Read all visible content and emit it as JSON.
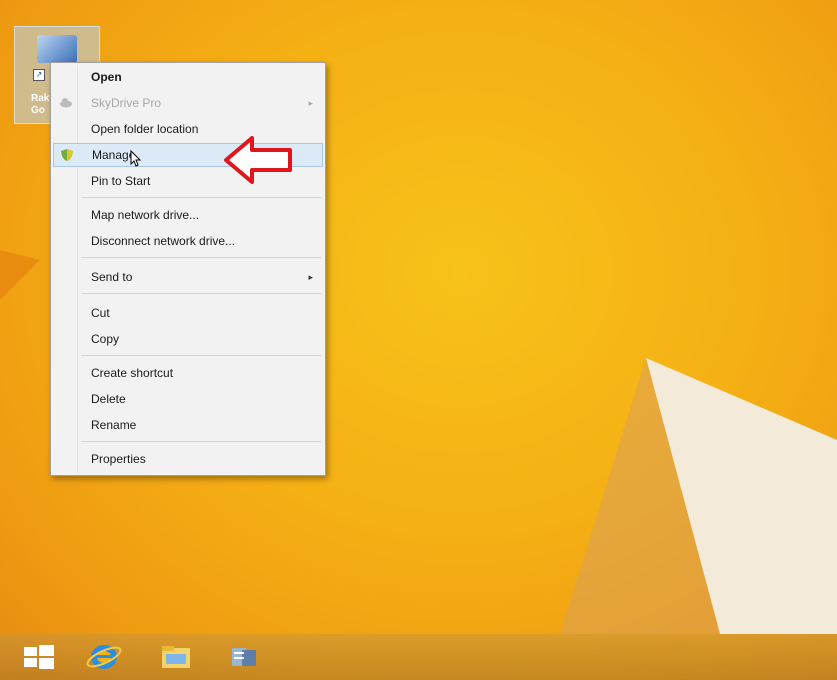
{
  "desktop_icon": {
    "label_line1": "Rak",
    "label_line2": "Go"
  },
  "context_menu": {
    "items": [
      {
        "label": "Open",
        "bold": true
      },
      {
        "label": "SkyDrive Pro",
        "disabled": true,
        "submenu": "▸"
      },
      {
        "label": "Open folder location"
      },
      {
        "label": "Manage",
        "highlighted": true
      },
      {
        "label": "Pin to Start"
      },
      {
        "label": "Map network drive..."
      },
      {
        "label": "Disconnect network drive..."
      },
      {
        "label": "Send to",
        "submenu": "▸"
      },
      {
        "label": "Cut"
      },
      {
        "label": "Copy"
      },
      {
        "label": "Create shortcut"
      },
      {
        "label": "Delete"
      },
      {
        "label": "Rename"
      },
      {
        "label": "Properties"
      }
    ]
  },
  "taskbar": {
    "items": [
      "start-icon",
      "internet-explorer-icon",
      "file-explorer-icon",
      "server-manager-icon"
    ]
  },
  "colors": {
    "desktop": "#f5b014",
    "callout_arrow": "#e0161c",
    "highlight": "#dceaf8"
  }
}
